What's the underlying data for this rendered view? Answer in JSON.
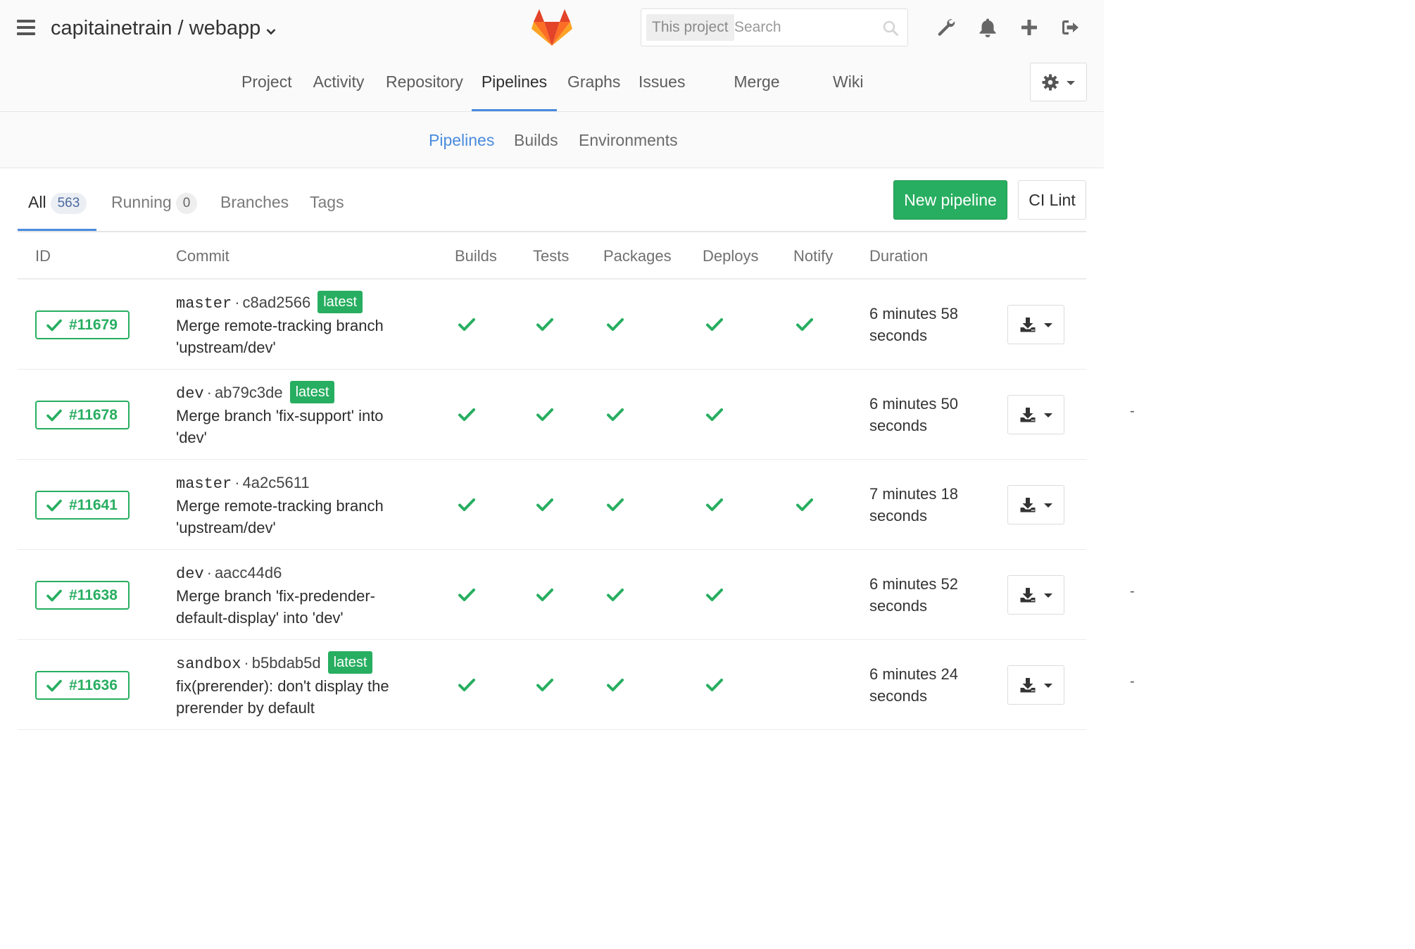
{
  "header": {
    "project_title": "capitainetrain / webapp",
    "search": {
      "scope": "This project",
      "placeholder": "Search"
    },
    "nav": [
      "Project",
      "Activity",
      "Repository",
      "Pipelines",
      "Graphs",
      "Issues",
      "Merge Requests",
      "Wiki"
    ],
    "active_nav": "Pipelines"
  },
  "subnav": {
    "items": [
      "Pipelines",
      "Builds",
      "Environments"
    ],
    "active": "Pipelines"
  },
  "tabs": [
    {
      "label": "All",
      "count": "563",
      "active": true
    },
    {
      "label": "Running",
      "count": "0",
      "active": false
    },
    {
      "label": "Branches",
      "active": false
    },
    {
      "label": "Tags",
      "active": false
    }
  ],
  "actions": {
    "new_pipeline": "New pipeline",
    "ci_lint": "CI Lint"
  },
  "columns": [
    "ID",
    "Commit",
    "Builds",
    "Tests",
    "Packages",
    "Deploys",
    "Notify",
    "Duration"
  ],
  "pipelines": [
    {
      "id": "#11679",
      "ref": "master",
      "sha": "c8ad2566",
      "latest": "latest",
      "message_line1": "Merge remote-tracking branch",
      "message_line2": "'upstream/dev'",
      "stages": [
        "success",
        "success",
        "success",
        "success",
        "success"
      ],
      "duration_line1": "6 minutes 58",
      "duration_line2": "seconds"
    },
    {
      "id": "#11678",
      "ref": "dev",
      "sha": "ab79c3de",
      "latest": "latest",
      "message_line1": "Merge branch 'fix-support' into",
      "message_line2": "'dev'",
      "stages": [
        "success",
        "success",
        "success",
        "success",
        "-"
      ],
      "duration_line1": "6 minutes 50",
      "duration_line2": "seconds"
    },
    {
      "id": "#11641",
      "ref": "master",
      "sha": "4a2c5611",
      "latest": "",
      "message_line1": "Merge remote-tracking branch",
      "message_line2": "'upstream/dev'",
      "stages": [
        "success",
        "success",
        "success",
        "success",
        "success"
      ],
      "duration_line1": "7 minutes 18",
      "duration_line2": "seconds"
    },
    {
      "id": "#11638",
      "ref": "dev",
      "sha": "aacc44d6",
      "latest": "",
      "message_line1": "Merge branch 'fix-predender-",
      "message_line2": "default-display' into 'dev'",
      "stages": [
        "success",
        "success",
        "success",
        "success",
        "-"
      ],
      "duration_line1": "6 minutes 52",
      "duration_line2": "seconds"
    },
    {
      "id": "#11636",
      "ref": "sandbox",
      "sha": "b5bdab5d",
      "latest": "latest",
      "message_line1": "fix(prerender): don't display the",
      "message_line2": "prerender by default",
      "stages": [
        "success",
        "success",
        "success",
        "success",
        "-"
      ],
      "duration_line1": "6 minutes 24",
      "duration_line2": "seconds"
    }
  ],
  "colors": {
    "success": "#27ae60",
    "accent": "#4a8bde"
  },
  "icons": [
    "hamburger-icon",
    "chevron-down-icon",
    "gitlab-logo",
    "search-icon",
    "wrench-icon",
    "bell-icon",
    "plus-icon",
    "sign-out-icon",
    "gear-icon",
    "check-icon",
    "download-icon"
  ]
}
